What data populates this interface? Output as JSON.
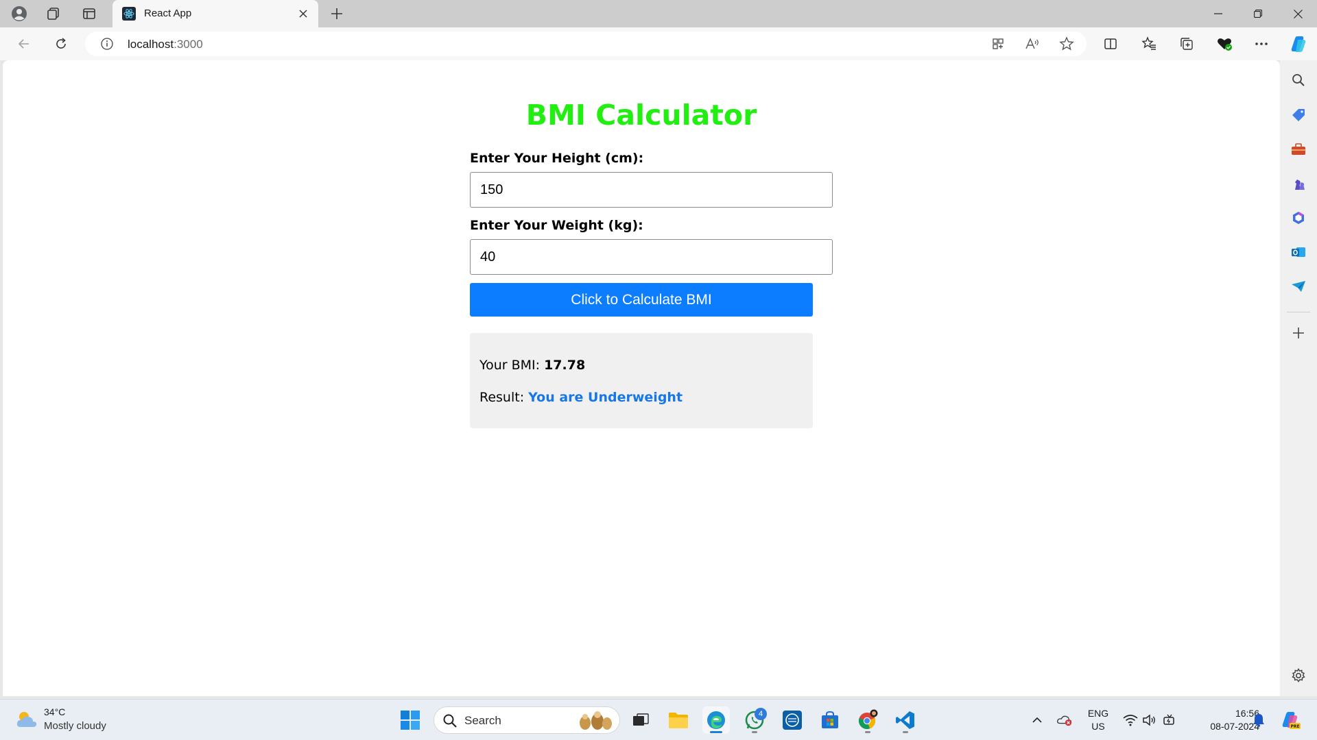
{
  "browser": {
    "tab_title": "React App",
    "url_host": "localhost",
    "url_port": ":3000"
  },
  "app": {
    "title": "BMI Calculator",
    "height_label": "Enter Your Height (cm):",
    "height_value": "150",
    "weight_label": "Enter Your Weight (kg):",
    "weight_value": "40",
    "button_label": "Click to Calculate BMI",
    "bmi_prefix": "Your BMI: ",
    "bmi_value": "17.78",
    "result_prefix": "Result: ",
    "result_value": "You are Underweight"
  },
  "taskbar": {
    "weather_temp": "34°C",
    "weather_cond": "Mostly cloudy",
    "search_label": "Search",
    "whatsapp_badge": "4",
    "lang_top": "ENG",
    "lang_bottom": "US",
    "time": "16:56",
    "date": "08-07-2024"
  },
  "colors": {
    "title_green": "#22ee11",
    "button_blue": "#0c7dff",
    "result_blue": "#1877e6"
  }
}
